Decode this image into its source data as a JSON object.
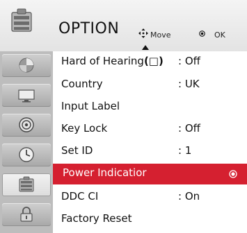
{
  "menu": {
    "title": "OPTION",
    "hints": {
      "move": "Move",
      "ok": "OK"
    }
  },
  "sidebar": {
    "items": [
      {
        "icon": "picture-icon"
      },
      {
        "icon": "screen-icon"
      },
      {
        "icon": "audio-icon"
      },
      {
        "icon": "clock-icon"
      },
      {
        "icon": "option-icon",
        "active": true
      },
      {
        "icon": "lock-icon"
      }
    ]
  },
  "options": {
    "hard_of_hearing": {
      "label": "Hard of Hearing",
      "symbol": "(□)",
      "value": ": Off"
    },
    "country": {
      "label": "Country",
      "value": ": UK"
    },
    "input_label": {
      "label": "Input Label"
    },
    "key_lock": {
      "label": "Key Lock",
      "value": ": Off"
    },
    "set_id": {
      "label": "Set ID",
      "value": ": 1"
    },
    "power_indicator": {
      "label": "Power Indicatior",
      "selected": true
    },
    "ddc_ci": {
      "label": "DDC CI",
      "value": ": On"
    },
    "factory_reset": {
      "label": "Factory Reset"
    }
  },
  "colors": {
    "highlight": "#d52030",
    "background": "#ffffff",
    "sidebar": "#bdbdbd"
  }
}
